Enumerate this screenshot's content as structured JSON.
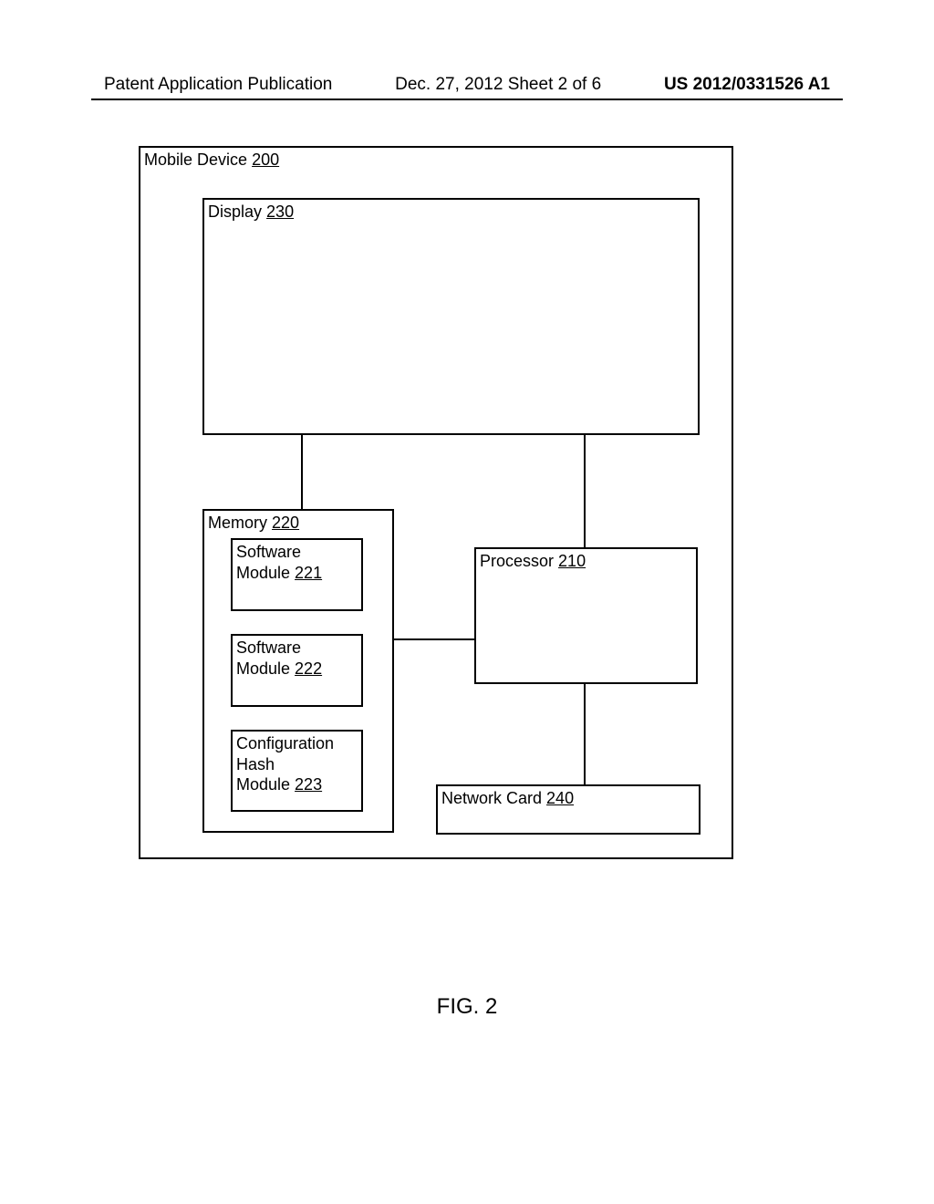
{
  "header": {
    "left": "Patent Application Publication",
    "center": "Dec. 27, 2012  Sheet 2 of 6",
    "right": "US 2012/0331526 A1"
  },
  "diagram": {
    "mobile_device": {
      "label": "Mobile Device",
      "ref": "200"
    },
    "display": {
      "label": "Display",
      "ref": "230"
    },
    "memory": {
      "label": "Memory",
      "ref": "220"
    },
    "software1": {
      "label": "Software\nModule",
      "ref": "221"
    },
    "software2": {
      "label": "Software\nModule",
      "ref": "222"
    },
    "config_hash": {
      "label": "Configuration\nHash\nModule",
      "ref": "223"
    },
    "processor": {
      "label": "Processor",
      "ref": "210"
    },
    "network_card": {
      "label": "Network Card",
      "ref": "240"
    }
  },
  "figure_caption": "FIG. 2"
}
